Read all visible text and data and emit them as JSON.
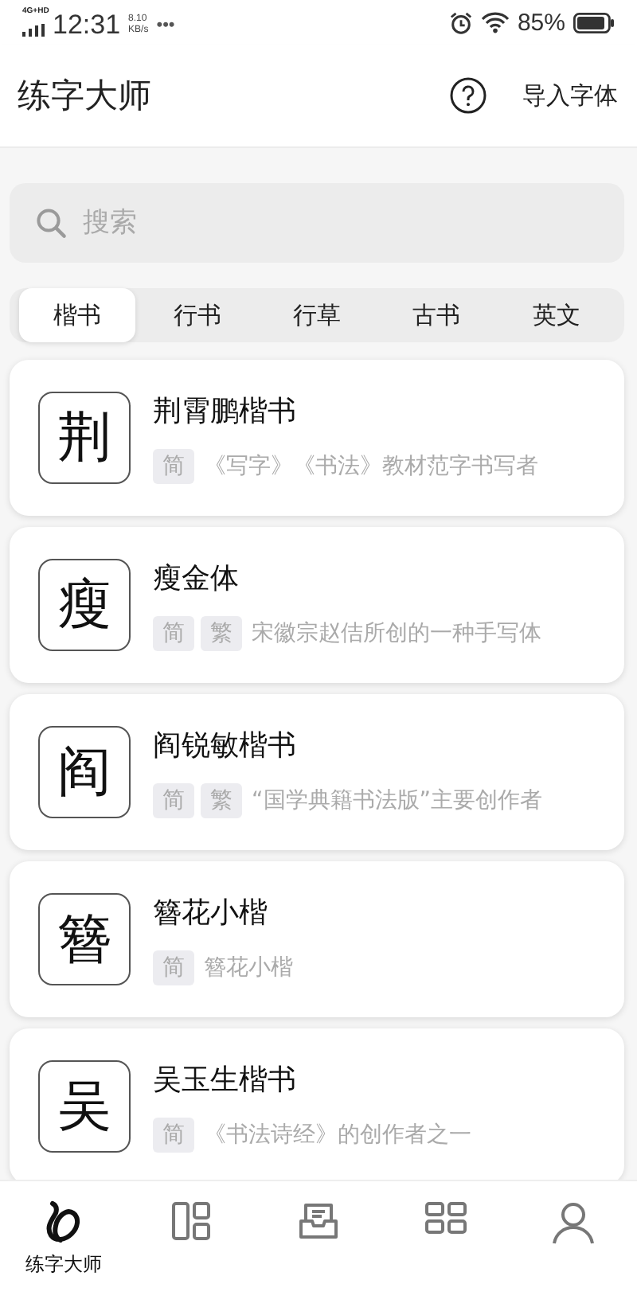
{
  "status_bar": {
    "network": "4G+HD",
    "time": "12:31",
    "speed_value": "8.10",
    "speed_unit": "KB/s",
    "more": "•••",
    "battery": "85%"
  },
  "header": {
    "title": "练字大师",
    "action": "导入字体"
  },
  "search": {
    "placeholder": "搜索"
  },
  "tabs": [
    {
      "label": "楷书",
      "selected": true
    },
    {
      "label": "行书",
      "selected": false
    },
    {
      "label": "行草",
      "selected": false
    },
    {
      "label": "古书",
      "selected": false
    },
    {
      "label": "英文",
      "selected": false
    }
  ],
  "fonts": [
    {
      "glyph": "荆",
      "name": "荆霄鹏楷书",
      "tags": [
        "简"
      ],
      "description": "《写字》《书法》教材范字书写者"
    },
    {
      "glyph": "瘦",
      "name": "瘦金体",
      "tags": [
        "简",
        "繁"
      ],
      "description": "宋徽宗赵佶所创的一种手写体"
    },
    {
      "glyph": "阎",
      "name": "阎锐敏楷书",
      "tags": [
        "简",
        "繁"
      ],
      "description": "“国学典籍书法版”主要创作者"
    },
    {
      "glyph": "簪",
      "name": "簪花小楷",
      "tags": [
        "简"
      ],
      "description": "簪花小楷"
    },
    {
      "glyph": "吴",
      "name": "吴玉生楷书",
      "tags": [
        "简"
      ],
      "description": "《书法诗经》的创作者之一"
    }
  ],
  "bottom_nav": [
    {
      "kind": "brush",
      "label": "练字大师",
      "selected": true
    },
    {
      "kind": "columns",
      "selected": false
    },
    {
      "kind": "inbox",
      "selected": false
    },
    {
      "kind": "grid",
      "selected": false
    },
    {
      "kind": "person",
      "selected": false
    }
  ]
}
